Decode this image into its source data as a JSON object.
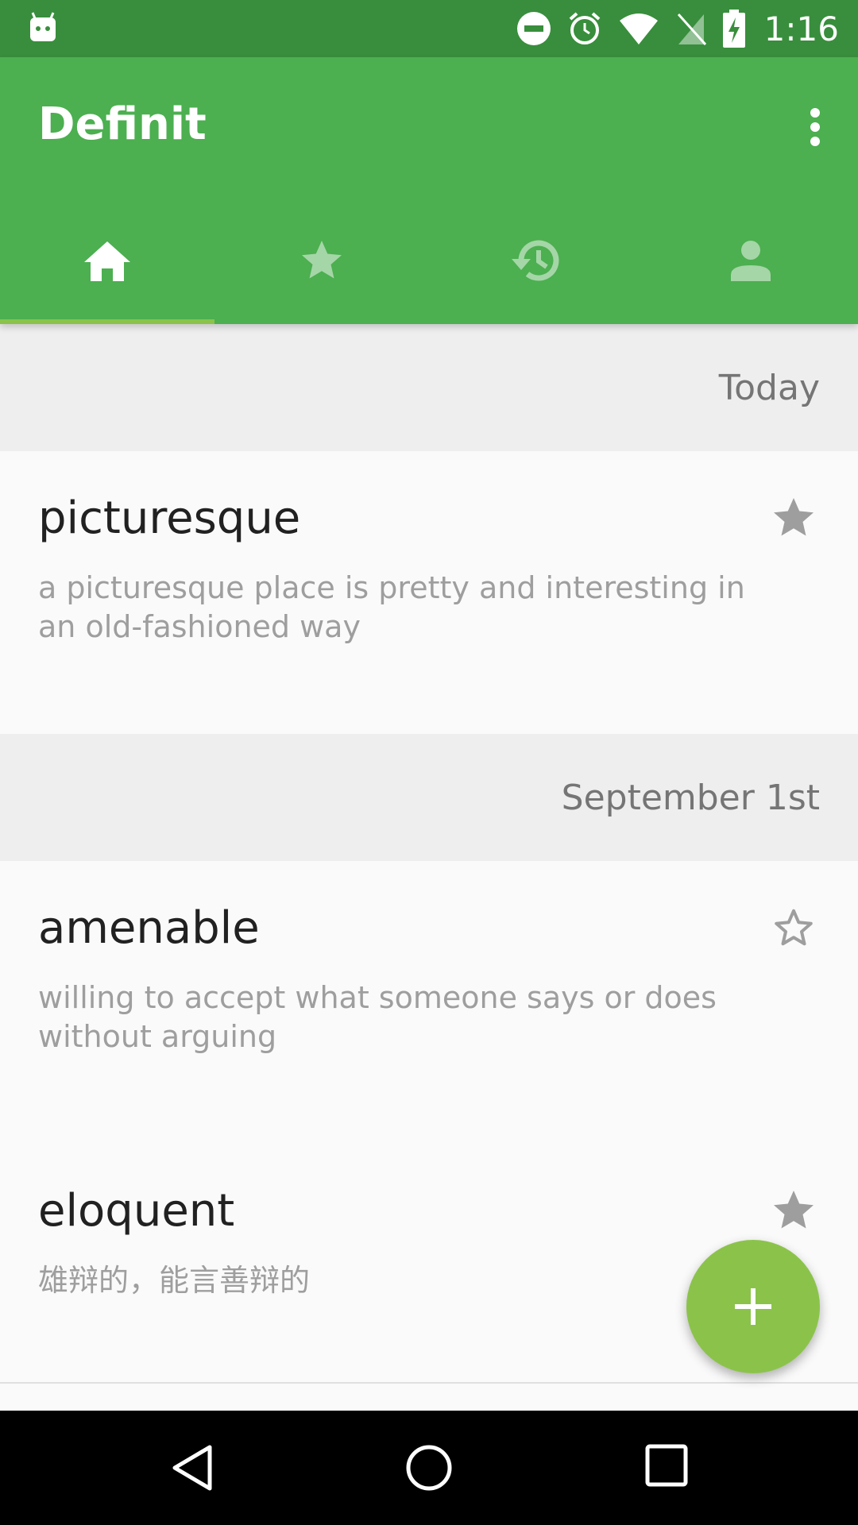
{
  "status_bar": {
    "time": "1:16",
    "icons": [
      "android-icon",
      "do-not-disturb-icon",
      "alarm-icon",
      "wifi-icon",
      "no-sim-icon",
      "battery-charging-icon"
    ]
  },
  "app_bar": {
    "title": "Definit",
    "menu_icon": "more-vert-icon"
  },
  "tabs": [
    {
      "icon": "home-icon",
      "active": true
    },
    {
      "icon": "star-icon",
      "active": false
    },
    {
      "icon": "history-icon",
      "active": false
    },
    {
      "icon": "person-icon",
      "active": false
    }
  ],
  "sections": [
    {
      "header": "Today",
      "entries": [
        {
          "word": "picturesque",
          "definition": "a picturesque place is pretty and interesting in an old-fashioned way",
          "starred": true
        }
      ]
    },
    {
      "header": "September 1st",
      "entries": [
        {
          "word": "amenable",
          "definition": "willing to accept what someone says or does without arguing",
          "starred": false
        },
        {
          "word": "eloquent",
          "definition": "雄辩的，能言善辩的",
          "starred": true
        }
      ]
    }
  ],
  "fab": {
    "icon": "plus-icon"
  },
  "nav_bar": {
    "icons": [
      "back-icon",
      "home-circle-icon",
      "recents-icon"
    ]
  },
  "colors": {
    "primary": "#4caf50",
    "primary_dark": "#388e3c",
    "accent": "#8bc34a",
    "section_bg": "#eeeeee",
    "card_bg": "#fafafa"
  }
}
